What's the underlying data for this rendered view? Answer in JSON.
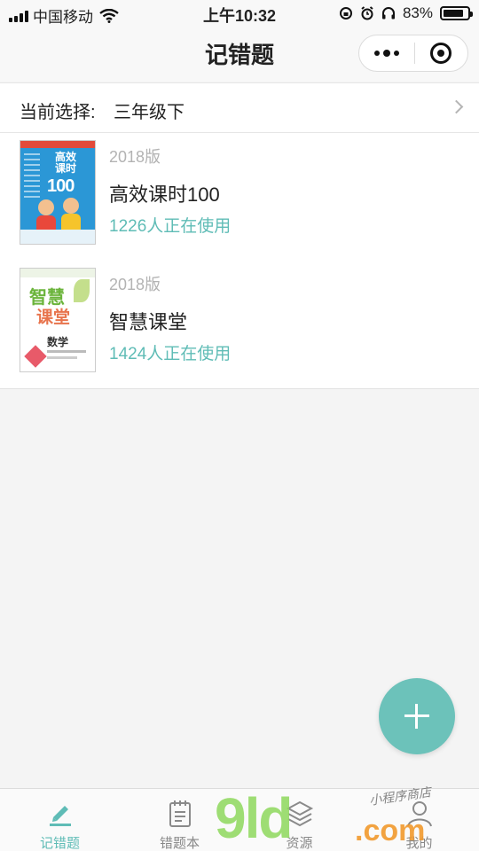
{
  "status_bar": {
    "carrier": "中国移动",
    "time": "上午10:32",
    "battery_percent": "83%",
    "battery_level": 0.83
  },
  "nav": {
    "title": "记错题"
  },
  "selection": {
    "label": "当前选择:",
    "value": "三年级下"
  },
  "books": [
    {
      "edition": "2018版",
      "title": "高效课时100",
      "users": "1226人正在使用",
      "cover_text": [
        "高效",
        "课时",
        "100"
      ]
    },
    {
      "edition": "2018版",
      "title": "智慧课堂",
      "users": "1424人正在使用",
      "cover_text": [
        "智慧",
        "课堂",
        "数学"
      ]
    }
  ],
  "tabs": [
    {
      "label": "记错题",
      "icon": "pen-edit-icon",
      "active": true
    },
    {
      "label": "错题本",
      "icon": "notebook-icon",
      "active": false
    },
    {
      "label": "资源",
      "icon": "layers-icon",
      "active": false
    },
    {
      "label": "我的",
      "icon": "user-icon",
      "active": false
    }
  ],
  "watermark": {
    "logo": "9ld",
    "domain": ".com",
    "script": "小程序商店"
  },
  "colors": {
    "accent": "#5fbcb6",
    "fab": "#6cc2ba",
    "muted_text": "#b3b3b3"
  }
}
